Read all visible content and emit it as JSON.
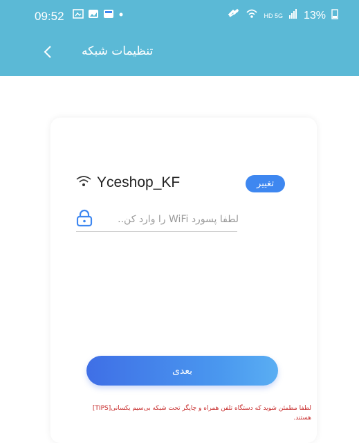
{
  "status_bar": {
    "time": "09:52",
    "battery": "13%",
    "network": "HD 5G"
  },
  "header": {
    "title": "تنظیمات شبکه"
  },
  "wifi": {
    "ssid": "Yceshop_KF",
    "change_label": "تغییر",
    "password_placeholder": "لطفا پسورد WiFi را وارد کن.."
  },
  "actions": {
    "next_label": "بعدی"
  },
  "tips": {
    "line1": "لطفا مطمئن شوید که دستگاه تلفن همراه و چاپگر تحت شبکه بی‌سیم یکسانی[TIPS]",
    "line2": "هستند."
  },
  "colors": {
    "header_bg": "#5bb9d6",
    "accent": "#3e87f0",
    "tips_text": "#c62828"
  }
}
